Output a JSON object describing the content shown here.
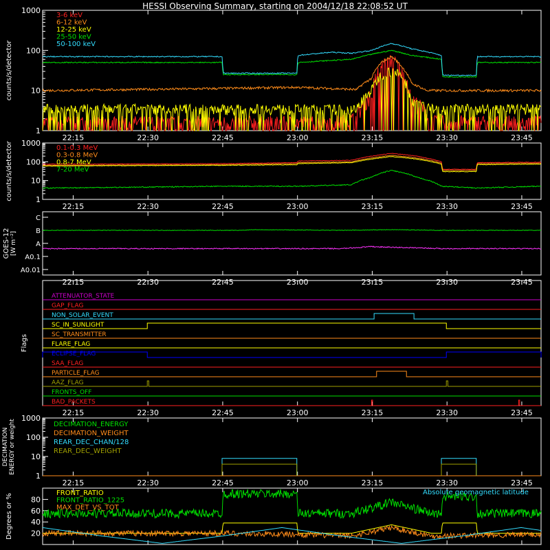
{
  "title": "HESSI Observing Summary, starting on 2004/12/18 22:08:52 UT",
  "colors": {
    "background": "#000000",
    "axis": "#ffffff",
    "red": "#ff2020",
    "orange": "#ff8c1a",
    "yellow": "#ffff00",
    "green": "#00e000",
    "cyan": "#33ddff",
    "magenta": "#ff33ff",
    "blue": "#0000ff",
    "olive": "#a0a000",
    "purple": "#cc00cc"
  },
  "x_axis": {
    "range_minutes": [
      0,
      100
    ],
    "tick_labels": [
      "22:15",
      "22:30",
      "22:45",
      "23:00",
      "23:15",
      "23:30",
      "23:45"
    ],
    "tick_minutes": [
      6.13,
      21.13,
      36.13,
      51.13,
      66.13,
      81.13,
      96.13
    ]
  },
  "chart_data": [
    {
      "id": "low_energy",
      "type": "line",
      "ylabel": "counts/s/detector",
      "yscale": "log",
      "ylim": [
        1,
        1000
      ],
      "ytick_labels": [
        "1",
        "10",
        "100",
        "1000"
      ],
      "series": [
        {
          "name": "3-6 keV",
          "color": "red",
          "noise": 0.45,
          "dropouts": true,
          "x": [
            0,
            36,
            36.2,
            51,
            51.2,
            60,
            63,
            66,
            68,
            70,
            72,
            74,
            78,
            100
          ],
          "y": [
            1.6,
            1.6,
            1.6,
            1.6,
            1.6,
            1.7,
            2,
            8,
            40,
            60,
            30,
            6,
            1.7,
            1.6
          ]
        },
        {
          "name": "6-12 keV",
          "color": "orange",
          "noise": 0.07,
          "x": [
            0,
            30,
            51,
            60,
            63,
            66,
            68,
            70,
            72,
            74,
            77,
            100
          ],
          "y": [
            10,
            11,
            12,
            11,
            10.5,
            20,
            50,
            70,
            40,
            15,
            10,
            10
          ]
        },
        {
          "name": "12-25 keV",
          "color": "yellow",
          "noise": 0.3,
          "dropouts": true,
          "x": [
            0,
            36,
            36.2,
            51,
            51.2,
            60,
            63,
            66,
            68,
            70,
            72,
            74,
            78,
            100
          ],
          "y": [
            3.5,
            3.5,
            3.5,
            3.5,
            3.5,
            3.4,
            3.4,
            10,
            25,
            32,
            22,
            6,
            3.5,
            3.5
          ]
        },
        {
          "name": "25-50 keV",
          "color": "green",
          "noise": 0.03,
          "x": [
            0,
            36,
            36.2,
            51,
            51.2,
            62,
            66,
            70,
            74,
            80,
            80.2,
            87,
            87.2,
            100
          ],
          "y": [
            50,
            50,
            25,
            25,
            50,
            60,
            80,
            100,
            75,
            60,
            22,
            22,
            50,
            50
          ]
        },
        {
          "name": "50-100 keV",
          "color": "cyan",
          "noise": 0.03,
          "x": [
            0,
            36,
            36.2,
            51,
            51.2,
            58,
            62,
            66,
            70,
            74,
            80,
            80.2,
            87,
            87.2,
            100
          ],
          "y": [
            70,
            70,
            27,
            27,
            75,
            90,
            85,
            100,
            150,
            110,
            75,
            24,
            24,
            70,
            70
          ]
        }
      ]
    },
    {
      "id": "high_energy",
      "type": "line",
      "ylabel": "counts/s/detector",
      "yscale": "log",
      "ylim": [
        1,
        1000
      ],
      "ytick_labels": [
        "1",
        "10",
        "100",
        "1000"
      ],
      "series": [
        {
          "name": "0.1-0.3 MeV",
          "color": "red",
          "noise": 0.03,
          "x": [
            0,
            36,
            51,
            51.2,
            62,
            66,
            70,
            75,
            80,
            80.2,
            87,
            87.2,
            100
          ],
          "y": [
            75,
            80,
            90,
            110,
            120,
            200,
            280,
            200,
            100,
            40,
            40,
            90,
            95
          ]
        },
        {
          "name": "0.3-0.8 MeV",
          "color": "orange",
          "noise": 0.03,
          "x": [
            0,
            36,
            51,
            51.2,
            62,
            66,
            70,
            75,
            80,
            80.2,
            87,
            87.2,
            100
          ],
          "y": [
            65,
            70,
            80,
            90,
            100,
            160,
            220,
            160,
            85,
            35,
            35,
            80,
            85
          ]
        },
        {
          "name": "0.8-7 MeV",
          "color": "yellow",
          "noise": 0.03,
          "x": [
            0,
            36,
            51,
            51.2,
            62,
            66,
            70,
            75,
            80,
            80.2,
            87,
            87.2,
            100
          ],
          "y": [
            60,
            65,
            70,
            80,
            90,
            140,
            190,
            140,
            75,
            30,
            30,
            70,
            75
          ]
        },
        {
          "name": "7-20 MeV",
          "color": "green",
          "noise": 0.06,
          "x": [
            0,
            20,
            36,
            51,
            62,
            66,
            70,
            75,
            80,
            87,
            100
          ],
          "y": [
            4,
            4.5,
            5,
            5,
            6,
            15,
            35,
            15,
            5,
            4,
            5
          ]
        }
      ]
    },
    {
      "id": "goes",
      "type": "line",
      "ylabel": "GOES-12 [W m^-2]",
      "ytick_labels": [
        "A0.01",
        "A0.1",
        "A",
        "B",
        "C"
      ],
      "series": [
        {
          "color": "green",
          "noise": 0.01,
          "x": [
            0,
            40,
            42,
            60,
            70,
            80,
            100
          ],
          "y": [
            2.0,
            2.0,
            2.05,
            2.0,
            2.05,
            2.0,
            2.0
          ]
        },
        {
          "color": "magenta",
          "noise": 0.06,
          "x": [
            0,
            60,
            66,
            70,
            76,
            80,
            100
          ],
          "y": [
            0.6,
            0.6,
            0.75,
            0.7,
            0.65,
            0.6,
            0.6
          ]
        }
      ]
    },
    {
      "id": "flags",
      "type": "line",
      "ylabel": "Flags",
      "flags": [
        {
          "name": "ATTENUATOR_STATE",
          "color": "purple",
          "on": []
        },
        {
          "name": "GAP_FLAG",
          "color": "red",
          "on": []
        },
        {
          "name": "NON_SOLAR_EVENT",
          "color": "cyan",
          "on": [
            [
              66.5,
              74.5
            ]
          ]
        },
        {
          "name": "SC_IN_SUNLIGHT",
          "color": "yellow",
          "on": [
            [
              21,
              81
            ]
          ]
        },
        {
          "name": "SC_TRANSMITTER",
          "color": "orange",
          "on": []
        },
        {
          "name": "FLARE_FLAG",
          "color": "yellow",
          "on": []
        },
        {
          "name": "ECLIPSE_FLAG",
          "color": "blue",
          "on": [
            [
              0,
              21
            ],
            [
              81,
              100
            ]
          ]
        },
        {
          "name": "SAA_FLAG",
          "color": "red",
          "on": []
        },
        {
          "name": "PARTICLE_FLAG",
          "color": "orange",
          "on": [
            [
              67,
              73
            ]
          ]
        },
        {
          "name": "AAZ_FLAG",
          "color": "olive",
          "on": [
            [
              21,
              21.3
            ],
            [
              81,
              81.3
            ]
          ]
        },
        {
          "name": "FRONTS_OFF",
          "color": "green",
          "on": []
        },
        {
          "name": "BAD_PACKETS",
          "color": "red",
          "on": [
            [
              66,
              66.2
            ],
            [
              95.5,
              95.7
            ]
          ]
        }
      ]
    },
    {
      "id": "decimation",
      "type": "line",
      "ylabel": "DECIMATION ENERGY or weight",
      "ylim": [
        1,
        1000
      ],
      "yscale": "log",
      "ytick_labels": [
        "1",
        "10",
        "100",
        "1000"
      ],
      "series": [
        {
          "name": "DECIMATION_ENERGY",
          "color": "green",
          "x": [
            0,
            100
          ],
          "y": [
            1,
            1
          ]
        },
        {
          "name": "DECIMATION_WEIGHT",
          "color": "orange",
          "x": [
            0,
            100
          ],
          "y": [
            1,
            1
          ]
        },
        {
          "name": "REAR_DEC_CHAN/128",
          "color": "cyan",
          "steps": [
            [
              36,
              51,
              8
            ],
            [
              80,
              87,
              8
            ]
          ]
        },
        {
          "name": "REAR_DEC_WEIGHT",
          "color": "olive",
          "steps": [
            [
              36,
              51,
              4
            ],
            [
              80,
              87,
              4
            ]
          ]
        }
      ]
    },
    {
      "id": "ratios",
      "type": "line",
      "ylabel": "Degrees or %",
      "ylim": [
        0,
        100
      ],
      "ytick_labels": [
        "20",
        "40",
        "60",
        "80"
      ],
      "annotation": "Absolute geomagnetic latitude",
      "series": [
        {
          "name": "FRONT_RATIO",
          "color": "yellow",
          "noise": 0.0,
          "x": [
            0,
            36,
            36.2,
            51,
            51.2,
            62,
            70,
            78,
            80,
            80.2,
            87,
            87.2,
            100
          ],
          "y": [
            20,
            20,
            38,
            38,
            20,
            20,
            35,
            20,
            20,
            38,
            38,
            20,
            20
          ]
        },
        {
          "name": "FRONT_RATIO_1225",
          "color": "green",
          "noise": 8,
          "x": [
            0,
            36,
            36.2,
            51,
            51.2,
            62,
            70,
            78,
            80,
            80.2,
            87,
            87.2,
            100
          ],
          "y": [
            55,
            55,
            90,
            90,
            55,
            55,
            75,
            55,
            55,
            85,
            85,
            55,
            55
          ]
        },
        {
          "name": "MAX_DET_VS_TOT",
          "color": "orange",
          "noise": 5,
          "x": [
            0,
            36,
            51,
            62,
            70,
            78,
            100
          ],
          "y": [
            20,
            20,
            18,
            15,
            30,
            15,
            18
          ]
        },
        {
          "color": "cyan",
          "noise": 0.0,
          "sine": true,
          "x": [
            0,
            12,
            24,
            36,
            48,
            60,
            72,
            84,
            96,
            100
          ],
          "y": [
            30,
            15,
            2,
            15,
            30,
            15,
            2,
            15,
            30,
            25
          ]
        }
      ]
    }
  ]
}
